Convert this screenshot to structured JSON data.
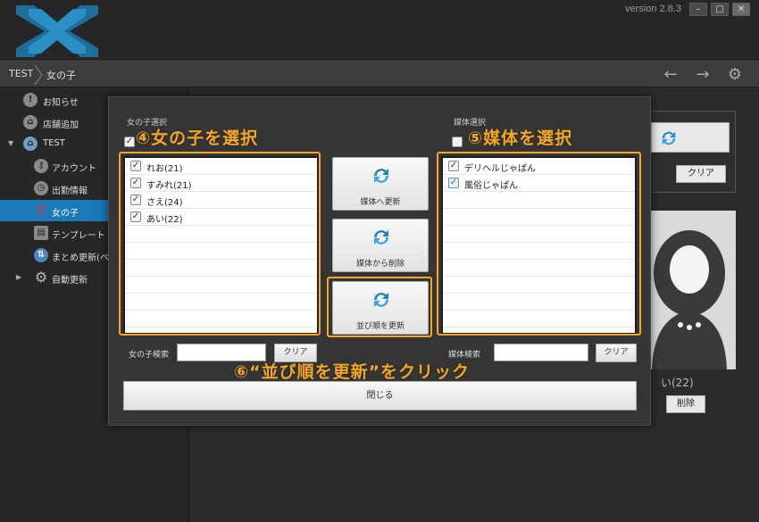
{
  "app": {
    "version": "version 2.8.3",
    "window_buttons": [
      "–",
      "□",
      "✕"
    ]
  },
  "breadcrumb": {
    "root": "TEST",
    "current": "女の子"
  },
  "toolbar": {
    "back_icon": "←",
    "forward_icon": "→",
    "settings_icon": "⚙"
  },
  "sidebar": {
    "items": [
      {
        "label": "お知らせ",
        "icon": "!"
      },
      {
        "label": "店舗追加",
        "icon": "⌂"
      },
      {
        "label": "TEST",
        "icon": "⌂"
      },
      {
        "label": "アカウント",
        "icon": "⚷"
      },
      {
        "label": "出勤情報",
        "icon": "◷"
      },
      {
        "label": "女の子",
        "icon": "♀"
      },
      {
        "label": "テンプレート",
        "icon": "▤"
      },
      {
        "label": "まとめ更新(ペー",
        "icon": "⇅"
      },
      {
        "label": "自動更新",
        "icon": "⚙"
      }
    ]
  },
  "background_panel": {
    "clear_label": "クリア",
    "name_partial": "い(22)",
    "delete_label": "削除"
  },
  "modal": {
    "girls_section_label": "女の子選択",
    "media_section_label": "媒体選択",
    "girls": [
      {
        "name": "れお(21)",
        "checked": true
      },
      {
        "name": "すみれ(21)",
        "checked": true
      },
      {
        "name": "さえ(24)",
        "checked": true
      },
      {
        "name": "あい(22)",
        "checked": true
      }
    ],
    "media": [
      {
        "name": "デリヘルじゃぱん",
        "checked": true
      },
      {
        "name": "風俗じゃぱん",
        "checked": true
      }
    ],
    "buttons": {
      "update_to_media": "媒体へ更新",
      "delete_from_media": "媒体から削除",
      "update_order": "並び順を更新"
    },
    "girl_search_label": "女の子検索",
    "girl_search_value": "",
    "media_search_label": "媒体検索",
    "media_search_value": "",
    "clear_label": "クリア",
    "close_label": "閉じる"
  },
  "annotations": {
    "step4": "④女の子を選択",
    "step5": "⑤媒体を選択",
    "step6": "⑥“並び順を更新”をクリック",
    "color": "#f5a623"
  }
}
